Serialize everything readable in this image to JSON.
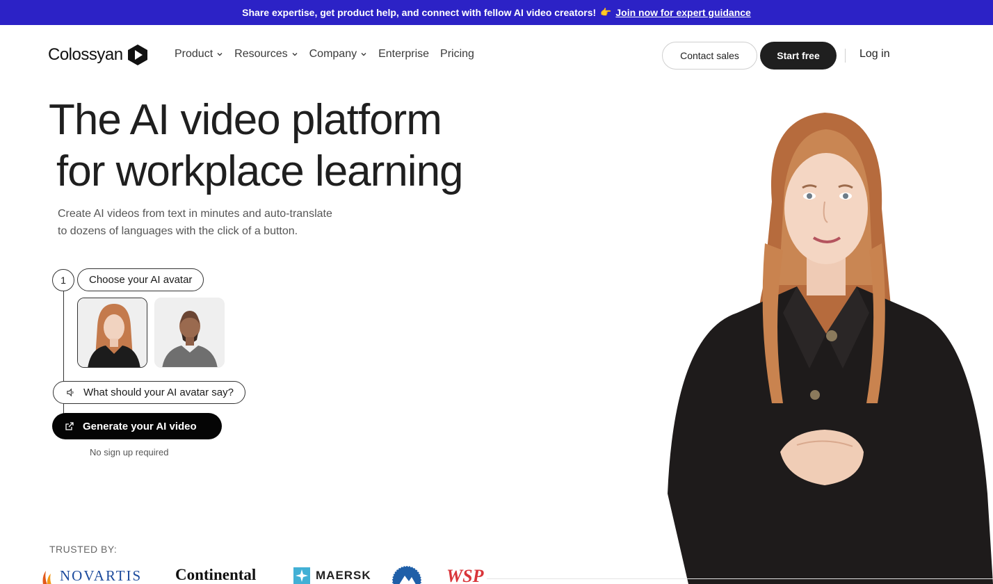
{
  "banner": {
    "text": "Share expertise, get product help, and connect with fellow AI video creators!",
    "emoji": "👉",
    "link": "Join now for expert guidance"
  },
  "nav": {
    "logo": "Colossyan",
    "menu": [
      {
        "label": "Product",
        "has_dropdown": true
      },
      {
        "label": "Resources",
        "has_dropdown": true
      },
      {
        "label": "Company",
        "has_dropdown": true
      },
      {
        "label": "Enterprise",
        "has_dropdown": false
      },
      {
        "label": "Pricing",
        "has_dropdown": false
      }
    ],
    "contact_sales": "Contact sales",
    "start_free": "Start free",
    "login": "Log in"
  },
  "hero": {
    "headline_line1": "The AI video platform",
    "headline_line2": "for workplace learning",
    "subtext_line1": "Create AI videos from text in minutes and auto-translate",
    "subtext_line2": "to dozens of languages with the click of a button."
  },
  "flow": {
    "step_number": "1",
    "step_label": "Choose your AI avatar",
    "say_prompt": "What should your AI avatar say?",
    "generate_button": "Generate your AI video",
    "note": "No sign up required"
  },
  "trusted": {
    "label": "TRUSTED BY:",
    "logos": [
      "NOVARTIS",
      "Continental",
      "MAERSK",
      "WSP"
    ]
  },
  "colors": {
    "banner": "#2c22c6",
    "primary_button": "#1f1f1f"
  }
}
